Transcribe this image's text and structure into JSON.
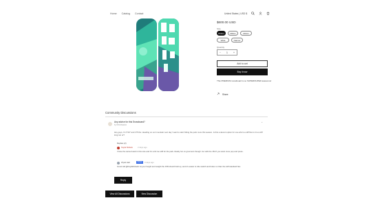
{
  "header": {
    "nav": [
      "Home",
      "Catalog",
      "Contact"
    ],
    "currency": "United States | USD $",
    "icons": [
      "search-icon",
      "account-icon",
      "cart-icon"
    ]
  },
  "product": {
    "price": "$600.00 USD",
    "size_label": "Size",
    "sizes": [
      "154cm",
      "158cm",
      "160cm"
    ],
    "style_label": "",
    "styles": [
      "Small",
      "Medium",
      "Large"
    ],
    "extra_options": [
      "Wide",
      "Narrow"
    ],
    "quantity_label": "Quantity",
    "quantity": "1",
    "add_to_cart": "Add to cart",
    "buy_now": "Buy it now",
    "description": "This PREMIUM snowboard is so SUPERDUPER awesome!",
    "share": "Share"
  },
  "community": {
    "title": "Community Discussions",
    "thread": {
      "title": "Any advice for this Snowboard?",
      "author": "by Chris Dawson",
      "question": "Hey guys, I'm 5'10\" and 175 lbs. Heading on our mountain next day I want to start hitting the park more this season. Is this a decent option for one who's a stiff flex is it too stiff long run or?",
      "replies_label": "Replies (2)",
      "reply1_author": "Kayla Nickels",
      "reply1_time": "2 days ago",
      "reply1_text": "I have the same board in this size and it's a bit too stiff for the park. Really fun on groomers though. Go with the 154 if you want more pop and press.",
      "reply2_author": "Wyatt Hall",
      "reply2_badge": "Owner",
      "reply2_time": "3 days ago",
      "reply2_text": "Good call @KaylaNickels! At your height and weight the 158 should hold up, and it's easier to ride switch and butter on than the stiff standard flex.",
      "reply_button": "Reply"
    },
    "view_all": "View All Discussions",
    "new_discussion": "New Discussion"
  },
  "colors": {
    "board_teal": "#1f7c7a",
    "board_mint": "#5fe3b6",
    "board_purple": "#6a58a8",
    "accent_red": "#c0392b",
    "badge_blue": "#3b6ee6"
  }
}
